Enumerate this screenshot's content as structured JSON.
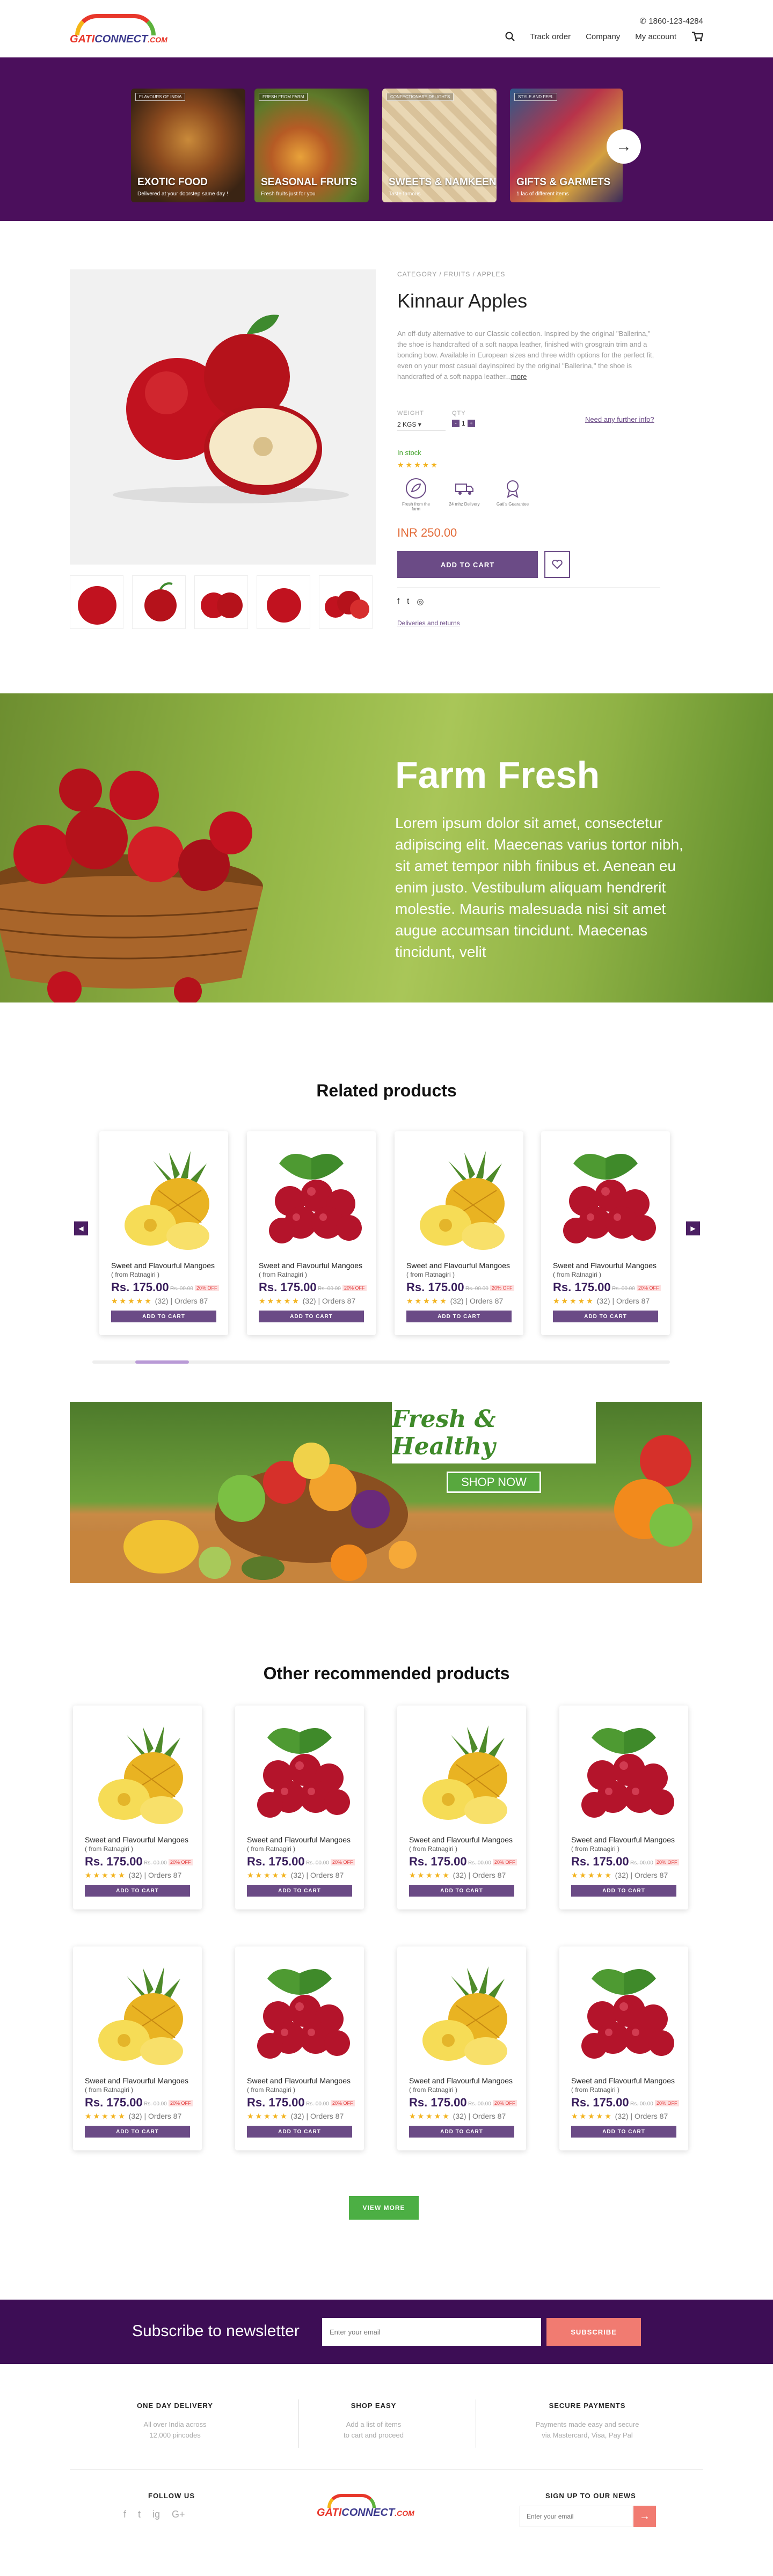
{
  "header": {
    "logo_prefix": "GATI",
    "logo_brand": "CONNECT",
    "logo_suffix": ".COM",
    "phone": "1860-123-4284",
    "nav": [
      "Track order",
      "Company",
      "My account"
    ]
  },
  "categories": [
    {
      "tag": "Flavours of India",
      "title": "EXOTIC FOOD",
      "subtitle": "Delivered at your doorstep same day !"
    },
    {
      "tag": "Fresh from farm",
      "title": "SEASONAL FRUITS",
      "subtitle": "Fresh fruits just for you"
    },
    {
      "tag": "Confectionary delights",
      "title": "SWEETS & NAMKEEN",
      "subtitle": "Taste famous"
    },
    {
      "tag": "Style and feel",
      "title": "GIFTS & GARMETS",
      "subtitle": "1 lac of different items"
    }
  ],
  "product": {
    "breadcrumb": "CATEGORY  /  FRUITS  /  APPLES",
    "title": "Kinnaur Apples",
    "description": "An off-duty alternative to our Classic collection. Inspired by the original \"Ballerina,\" the shoe is handcrafted of a soft nappa leather, finished with grosgrain trim and a bonding bow. Available in European sizes and three width options for the perfect fit, even on your most casual dayInspired by the original \"Ballerina,\" the shoe is handcrafted of a soft nappa leather...",
    "more_link": "more",
    "weight_label": "WEIGHT",
    "weight_value": "2 KGS",
    "qty_label": "QTY",
    "qty_value": "1",
    "help_link": "Need any further info?",
    "stock": "In stock",
    "rating": "★★★★★",
    "features": [
      "Fresh from the farm",
      "24 mhz Delivery",
      "Gati's Guarantee"
    ],
    "price": "INR 250.00",
    "add_to_cart": "ADD TO CART",
    "delivery_link": "Deliveries and returns"
  },
  "farm": {
    "title": "Farm Fresh",
    "text": "Lorem ipsum dolor sit amet, consectetur adipiscing elit. Maecenas varius tortor nibh, sit amet tempor nibh finibus et. Aenean eu enim justo. Vestibulum aliquam hendrerit molestie. Mauris malesuada nisi sit amet augue accumsan tincidunt. Maecenas tincidunt, velit"
  },
  "related": {
    "title": "Related products",
    "items": [
      {
        "fruit": "pineapple",
        "name": "Sweet and Flavourful Mangoes",
        "seller": "( from Ratnagiri )",
        "price": "Rs. 175.00",
        "old": "Rs. 00.00",
        "off": "20% OFF",
        "stars": "★★★★★",
        "reviews": "(32)",
        "orders": "Orders 87",
        "btn": "ADD TO CART"
      },
      {
        "fruit": "cherry",
        "name": "Sweet and Flavourful Mangoes",
        "seller": "( from Ratnagiri )",
        "price": "Rs. 175.00",
        "old": "Rs. 00.00",
        "off": "20% OFF",
        "stars": "★★★★★",
        "reviews": "(32)",
        "orders": "Orders 87",
        "btn": "ADD TO CART"
      },
      {
        "fruit": "pineapple",
        "name": "Sweet and Flavourful Mangoes",
        "seller": "( from Ratnagiri )",
        "price": "Rs. 175.00",
        "old": "Rs. 00.00",
        "off": "20% OFF",
        "stars": "★★★★★",
        "reviews": "(32)",
        "orders": "Orders 87",
        "btn": "ADD TO CART"
      },
      {
        "fruit": "cherry",
        "name": "Sweet and Flavourful Mangoes",
        "seller": "( from Ratnagiri )",
        "price": "Rs. 175.00",
        "old": "Rs. 00.00",
        "off": "20% OFF",
        "stars": "★★★★★",
        "reviews": "(32)",
        "orders": "Orders 87",
        "btn": "ADD TO CART"
      }
    ]
  },
  "promo": {
    "title": "Fresh & Healthy",
    "cta": "SHOP NOW"
  },
  "recommended": {
    "title": "Other recommended products",
    "view_more": "VIEW MORE",
    "items": [
      {
        "fruit": "pineapple",
        "name": "Sweet and Flavourful Mangoes",
        "seller": "( from Ratnagiri )",
        "price": "Rs. 175.00",
        "old": "Rs. 00.00",
        "off": "20% OFF",
        "stars": "★★★★★",
        "reviews": "(32)",
        "orders": "Orders 87",
        "btn": "ADD TO CART"
      },
      {
        "fruit": "cherry",
        "name": "Sweet and Flavourful Mangoes",
        "seller": "( from Ratnagiri )",
        "price": "Rs. 175.00",
        "old": "Rs. 00.00",
        "off": "20% OFF",
        "stars": "★★★★★",
        "reviews": "(32)",
        "orders": "Orders 87",
        "btn": "ADD TO CART"
      },
      {
        "fruit": "pineapple",
        "name": "Sweet and Flavourful Mangoes",
        "seller": "( from Ratnagiri )",
        "price": "Rs. 175.00",
        "old": "Rs. 00.00",
        "off": "20% OFF",
        "stars": "★★★★★",
        "reviews": "(32)",
        "orders": "Orders 87",
        "btn": "ADD TO CART"
      },
      {
        "fruit": "cherry",
        "name": "Sweet and Flavourful Mangoes",
        "seller": "( from Ratnagiri )",
        "price": "Rs. 175.00",
        "old": "Rs. 00.00",
        "off": "20% OFF",
        "stars": "★★★★★",
        "reviews": "(32)",
        "orders": "Orders 87",
        "btn": "ADD TO CART"
      },
      {
        "fruit": "pineapple",
        "name": "Sweet and Flavourful Mangoes",
        "seller": "( from Ratnagiri )",
        "price": "Rs. 175.00",
        "old": "Rs. 00.00",
        "off": "20% OFF",
        "stars": "★★★★★",
        "reviews": "(32)",
        "orders": "Orders 87",
        "btn": "ADD TO CART"
      },
      {
        "fruit": "cherry",
        "name": "Sweet and Flavourful Mangoes",
        "seller": "( from Ratnagiri )",
        "price": "Rs. 175.00",
        "old": "Rs. 00.00",
        "off": "20% OFF",
        "stars": "★★★★★",
        "reviews": "(32)",
        "orders": "Orders 87",
        "btn": "ADD TO CART"
      },
      {
        "fruit": "pineapple",
        "name": "Sweet and Flavourful Mangoes",
        "seller": "( from Ratnagiri )",
        "price": "Rs. 175.00",
        "old": "Rs. 00.00",
        "off": "20% OFF",
        "stars": "★★★★★",
        "reviews": "(32)",
        "orders": "Orders 87",
        "btn": "ADD TO CART"
      },
      {
        "fruit": "cherry",
        "name": "Sweet and Flavourful Mangoes",
        "seller": "( from Ratnagiri )",
        "price": "Rs. 175.00",
        "old": "Rs. 00.00",
        "off": "20% OFF",
        "stars": "★★★★★",
        "reviews": "(32)",
        "orders": "Orders 87",
        "btn": "ADD TO CART"
      }
    ]
  },
  "newsletter": {
    "title": "Subscribe to newsletter",
    "placeholder": "Enter your email",
    "button": "SUBSCRIBE"
  },
  "footer": {
    "features": [
      {
        "title": "ONE DAY DELIVERY",
        "line1": "All over India across",
        "line2": "12,000 pincodes"
      },
      {
        "title": "SHOP EASY",
        "line1": "Add a list of items",
        "line2": "to cart and proceed"
      },
      {
        "title": "SECURE PAYMENTS",
        "line1": "Payments made easy and secure",
        "line2": "via Mastercard, Visa, Pay Pal"
      }
    ],
    "follow_us": "FOLLOW US",
    "social": [
      "f",
      "t",
      "ig",
      "G+"
    ],
    "signup_title": "SIGN UP TO OUR NEWS",
    "email_placeholder": "Enter your email",
    "go": "→"
  },
  "colors": {
    "purple": "#4b0f5c",
    "accent": "#6b4b86",
    "green": "#4caf44",
    "coral": "#f17b71"
  }
}
